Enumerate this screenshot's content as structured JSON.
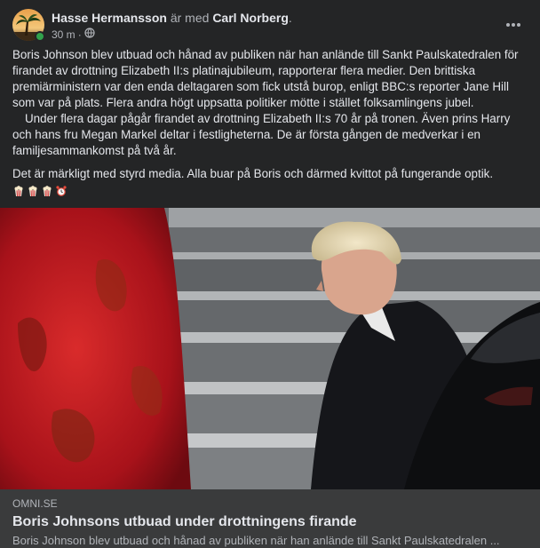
{
  "post": {
    "author": "Hasse Hermansson",
    "with_text": "är med",
    "tagged": "Carl Norberg",
    "period": ".",
    "time": "30 m",
    "separator": "·",
    "privacy_icon": "globe-icon",
    "more_icon": "more-horizontal-icon",
    "online": true,
    "paragraphs": [
      "Boris Johnson blev utbuad och hånad av publiken när han anlände till Sankt Paulskatedralen för firandet av drottning Elizabeth II:s platinajubileum, rapporterar flera medier. Den brittiska premiärministern var den enda deltagaren som fick utstå burop, enligt BBC:s reporter Jane Hill som var på plats. Flera andra högt uppsatta politiker mötte i stället folksamlingens jubel.",
      "Under flera dagar pågår firandet av drottning Elizabeth II:s 70 år på tronen. Även prins Harry och hans fru Megan Markel deltar i festligheterna. De är första gången de medverkar i en familjesammankomst på två år.",
      "Det är märkligt med styrd media. Alla buar på Boris och därmed kvittot på fungerande optik."
    ],
    "emojis": [
      "popcorn-icon",
      "popcorn-icon",
      "popcorn-icon",
      "alarm-clock-icon"
    ]
  },
  "link": {
    "domain": "OMNI.SE",
    "title": "Boris Johnsons utbuad under drottningens firande",
    "description": "Boris Johnson blev utbuad och hånad av publiken när han anlände till Sankt Paulskatedralen ..."
  },
  "colors": {
    "background": "#242526",
    "link_panel": "#3a3b3c",
    "text_primary": "#e4e6eb",
    "text_secondary": "#b0b3b8",
    "online": "#31a24c"
  }
}
